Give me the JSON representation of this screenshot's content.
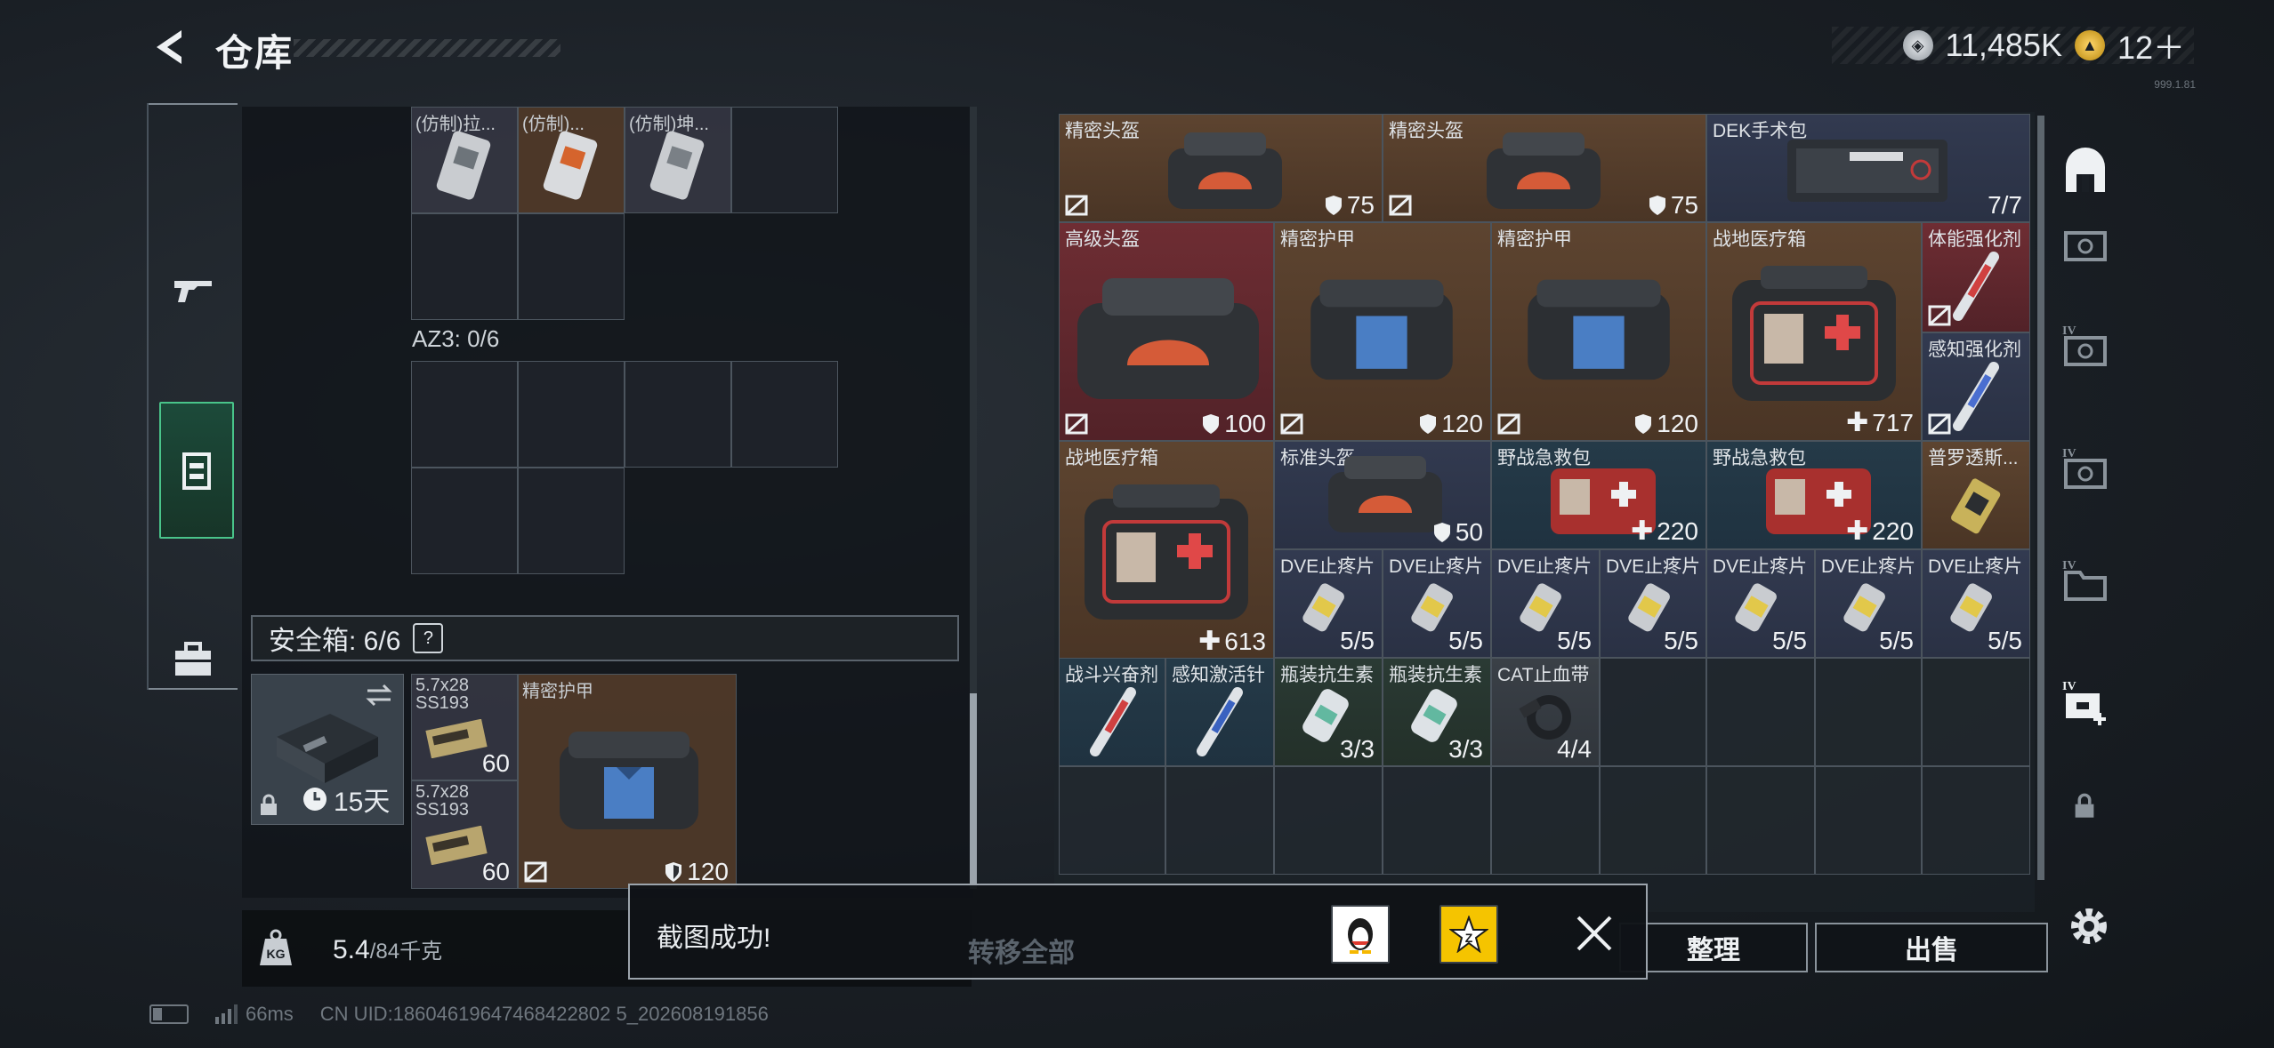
{
  "header": {
    "title": "仓库",
    "currency": {
      "coins": "11,485K",
      "tokens": "12＋"
    },
    "version": "999.1.81"
  },
  "sidebar": {
    "tabs": [
      "weapon",
      "backpack",
      "container",
      "toolbox"
    ]
  },
  "storage": {
    "top_items": [
      "(仿制)拉...",
      "(仿制)...",
      "(仿制)坤..."
    ],
    "az3_label": "AZ3: 0/6",
    "safe_label": "安全箱: 6/6",
    "help": "?",
    "safebox_time": "15天",
    "safe_items": [
      {
        "name": "5.7x28 SS193",
        "count": "60"
      },
      {
        "name": "5.7x28 SS193",
        "count": "60"
      },
      {
        "name": "精密护甲",
        "value": "120"
      }
    ],
    "weight_value": "5.4",
    "weight_max": "/84千克"
  },
  "grid": {
    "rows": [
      [
        {
          "name": "精密头盔",
          "value": "75"
        },
        {
          "name": "精密头盔",
          "value": "75"
        },
        {
          "name": "DEK手术包",
          "value": "7/7"
        }
      ],
      [
        {
          "name": "高级头盔",
          "value": "100"
        },
        {
          "name": "精密护甲",
          "value": "120"
        },
        {
          "name": "精密护甲",
          "value": "120"
        },
        {
          "name": "战地医疗箱",
          "value": "717"
        },
        {
          "name": "体能强化剂"
        },
        {
          "name": "感知强化剂"
        }
      ],
      [
        {
          "name": "战地医疗箱",
          "value": "613"
        },
        {
          "name": "标准头盔",
          "value": "50"
        },
        {
          "name": "野战急救包",
          "value": "220"
        },
        {
          "name": "野战急救包",
          "value": "220"
        },
        {
          "name": "普罗透斯..."
        }
      ],
      [
        {
          "name": "DVE止疼片",
          "value": "5/5"
        },
        {
          "name": "DVE止疼片",
          "value": "5/5"
        },
        {
          "name": "DVE止疼片",
          "value": "5/5"
        },
        {
          "name": "DVE止疼片",
          "value": "5/5"
        },
        {
          "name": "DVE止疼片",
          "value": "5/5"
        },
        {
          "name": "DVE止疼片",
          "value": "5/5"
        },
        {
          "name": "DVE止疼片",
          "value": "5/5"
        }
      ],
      [
        {
          "name": "战斗兴奋剂"
        },
        {
          "name": "感知激活针"
        },
        {
          "name": "瓶装抗生素",
          "value": "3/3"
        },
        {
          "name": "瓶装抗生素",
          "value": "3/3"
        },
        {
          "name": "CAT止血带",
          "value": "4/4"
        }
      ]
    ]
  },
  "buttons": {
    "transfer_all": "转移全部",
    "organize": "整理",
    "sell": "出售"
  },
  "toast": {
    "message": "截图成功!"
  },
  "status": {
    "ping": "66ms",
    "uid": "CN UID:18604619647468422802 5_202608191856"
  }
}
